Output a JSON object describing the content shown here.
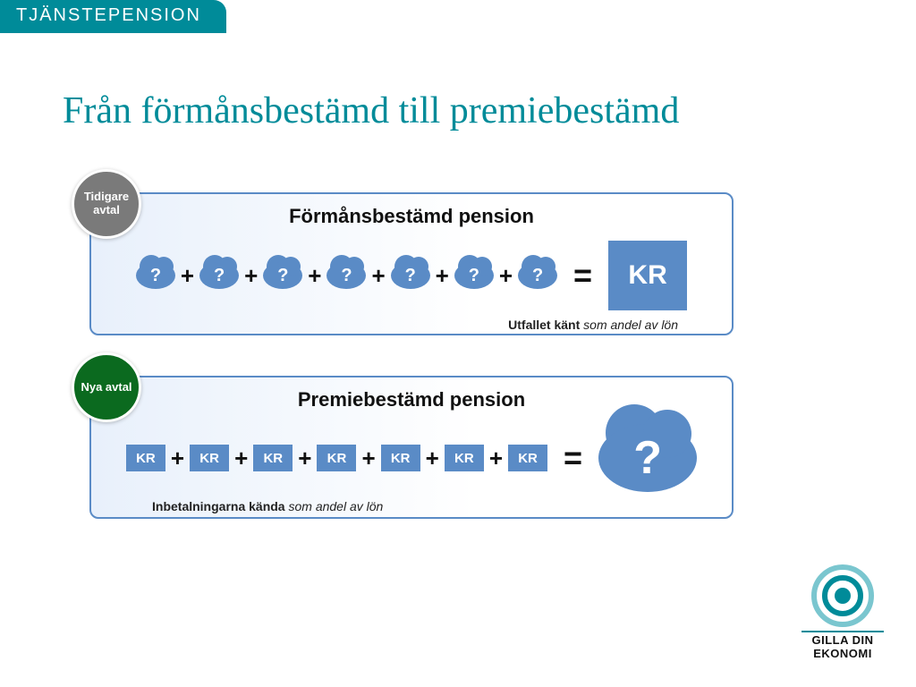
{
  "header": {
    "tab": "TJÄNSTEPENSION"
  },
  "title": "Från förmånsbestämd till premiebestämd",
  "panels": [
    {
      "badge": "Tidigare avtal",
      "heading": "Förmånsbestämd pension",
      "cloud_label": "?",
      "plus": "+",
      "equals": "=",
      "result_label": "KR",
      "caption_bold": "Utfallet känt",
      "caption_rest": " som andel av lön"
    },
    {
      "badge": "Nya avtal",
      "heading": "Premiebestämd pension",
      "kr_label": "KR",
      "plus": "+",
      "equals": "=",
      "result_cloud": "?",
      "caption_bold": "Inbetalningarna kända",
      "caption_rest": " som andel av lön"
    }
  ],
  "logo": {
    "line1": "GILLA DIN",
    "line2": "EKONOMI"
  },
  "colors": {
    "teal": "#008b99",
    "blue": "#5a8bc6",
    "gray": "#7a7a7a",
    "green": "#0b6a1f"
  }
}
